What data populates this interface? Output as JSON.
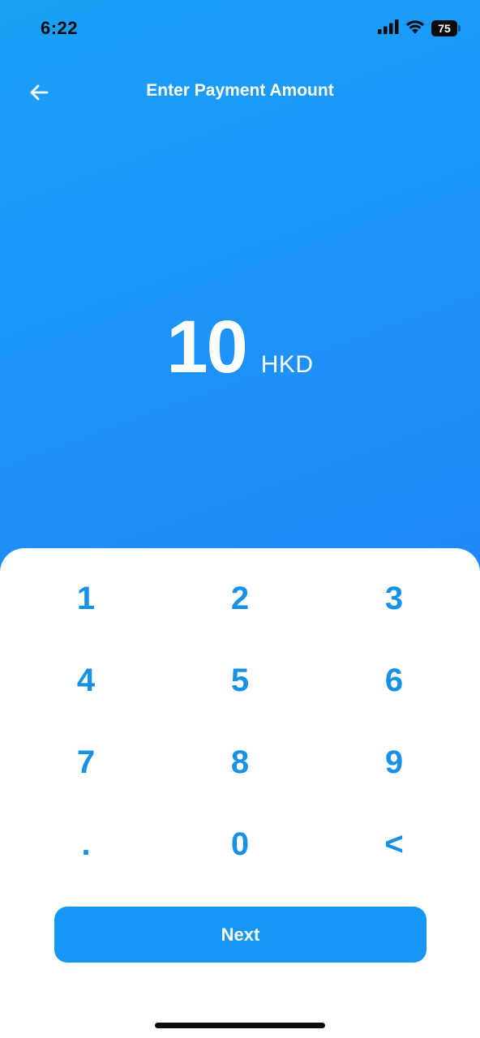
{
  "status_bar": {
    "time": "6:22",
    "battery": "75",
    "icons": [
      "signal-icon",
      "wifi-icon",
      "battery-icon"
    ]
  },
  "header": {
    "title": "Enter Payment Amount",
    "back_icon": "arrow-left-icon"
  },
  "amount": {
    "value": "10",
    "currency": "HKD"
  },
  "keypad": {
    "keys": [
      "1",
      "2",
      "3",
      "4",
      "5",
      "6",
      "7",
      "8",
      "9",
      ".",
      "0",
      "<"
    ]
  },
  "next_button": {
    "label": "Next"
  },
  "colors": {
    "gradient_start": "#1aa0f7",
    "gradient_end": "#2b74fb",
    "key_text": "#1591e6",
    "button_bg": "#1696f5"
  }
}
